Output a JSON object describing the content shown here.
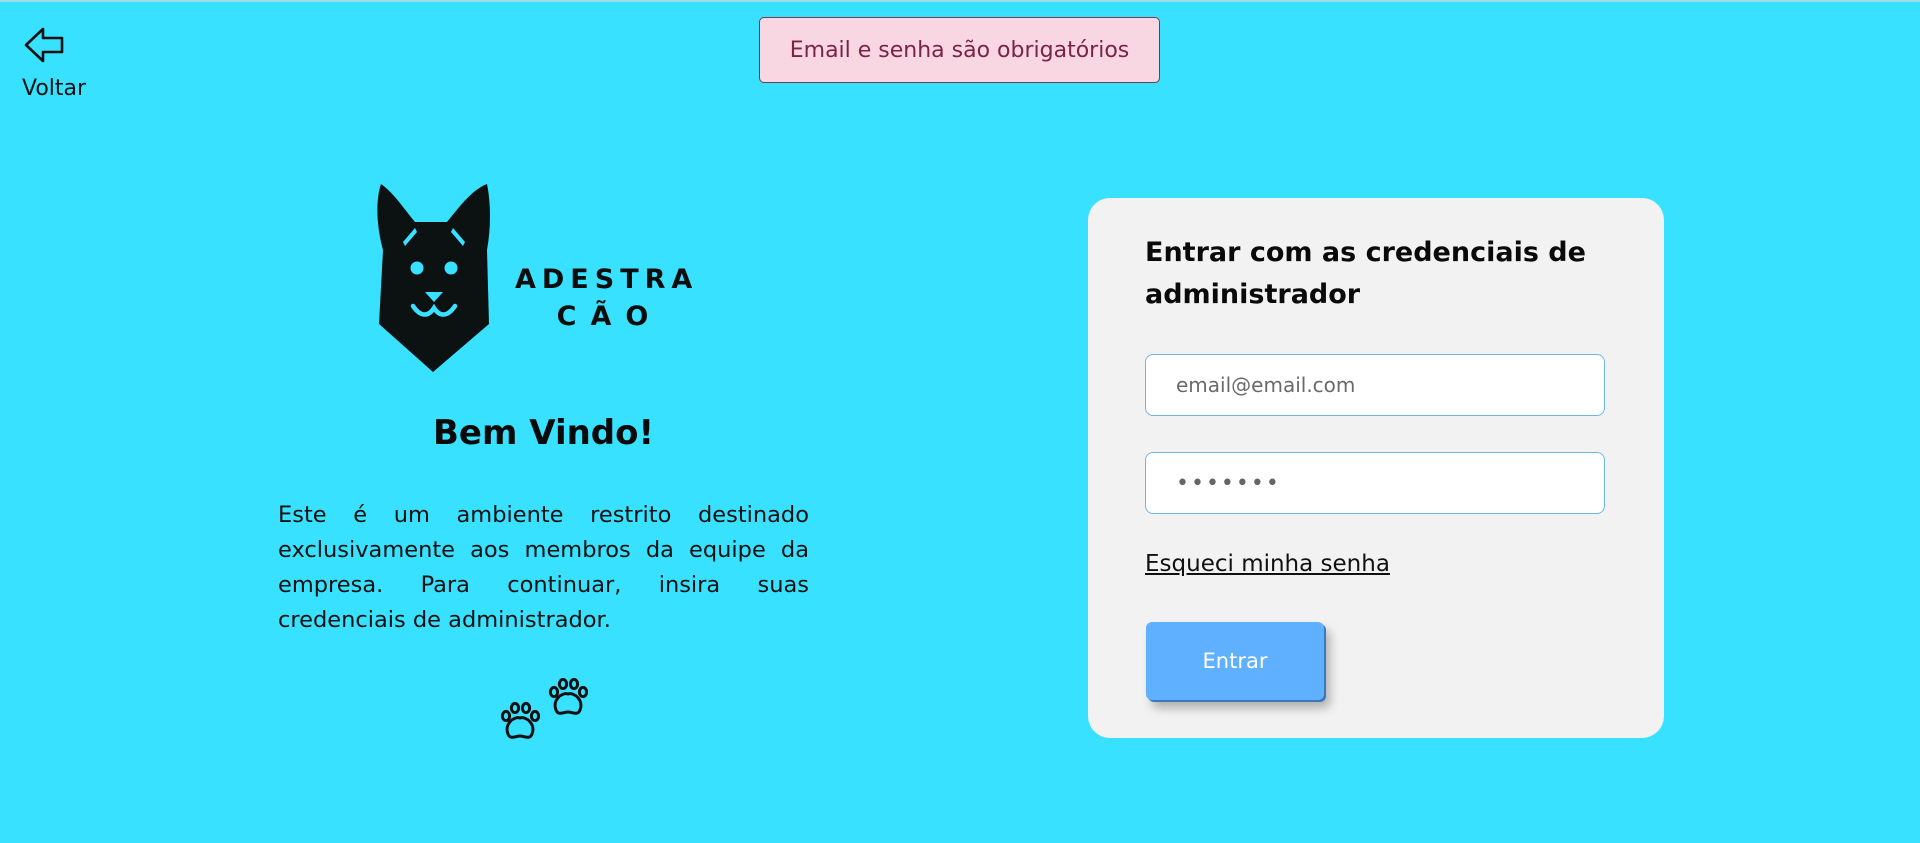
{
  "nav": {
    "back_label": "Voltar",
    "back_icon": "arrow-left-outline-icon"
  },
  "toast": {
    "message": "Email e senha são obrigatórios",
    "background": "#f8d7e3",
    "text_color": "#7a2346"
  },
  "brand": {
    "line1": "ADESTRA",
    "line2": "CÃO",
    "logo_icon": "dog-head-icon"
  },
  "welcome": {
    "title": "Bem Vindo!",
    "description": "Este é um ambiente restrito destinado exclusivamente aos membros da equipe da empresa. Para continuar, insira suas credenciais de administrador.",
    "decoration_icon": "paw-prints-icon"
  },
  "login": {
    "title": "Entrar com as credenciais de administrador",
    "email_placeholder": "email@email.com",
    "email_value": "",
    "password_value": "•••••••",
    "forgot_label": "Esqueci minha senha",
    "submit_label": "Entrar"
  },
  "colors": {
    "background": "#38e1ff",
    "card": "#f2f2f2",
    "button": "#5fb1ff",
    "input_border": "#6fb6e8"
  }
}
